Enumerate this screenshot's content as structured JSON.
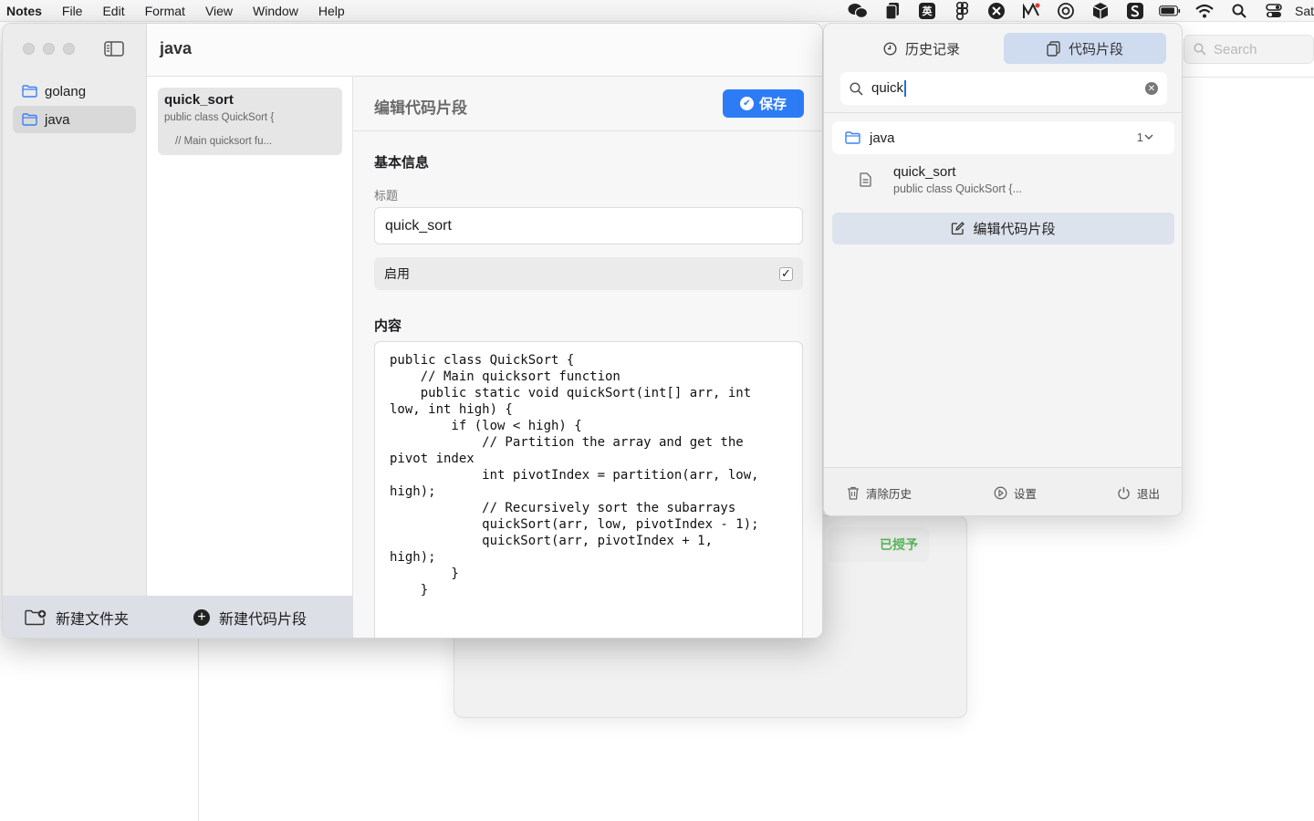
{
  "menubar": {
    "app": "Notes",
    "items": [
      "File",
      "Edit",
      "Format",
      "View",
      "Window",
      "Help"
    ],
    "tray": {
      "ime": "英",
      "overflow_text": "Sat"
    }
  },
  "window": {
    "title": "java",
    "sidebar": {
      "folders": [
        {
          "label": "golang"
        },
        {
          "label": "java"
        }
      ],
      "new_folder_label": "新建文件夹"
    },
    "snippet_list": {
      "items": [
        {
          "title": "quick_sort",
          "line1": "public class QuickSort {",
          "line2": "// Main quicksort fu..."
        }
      ],
      "new_snippet_label": "新建代码片段"
    },
    "editor": {
      "heading": "编辑代码片段",
      "save_label": "保存",
      "basic_info_title": "基本信息",
      "title_label": "标题",
      "title_value": "quick_sort",
      "enable_label": "启用",
      "enabled": true,
      "content_title": "内容",
      "code_lines": [
        "public class QuickSort {",
        "",
        "    // Main quicksort function",
        "    public static void quickSort(int[] arr, int",
        "low, int high) {",
        "        if (low < high) {",
        "            // Partition the array and get the",
        "pivot index",
        "            int pivotIndex = partition(arr, low,",
        "high);",
        "",
        "            // Recursively sort the subarrays",
        "            quickSort(arr, low, pivotIndex - 1);",
        "            quickSort(arr, pivotIndex + 1,",
        "high);",
        "        }",
        "    }"
      ]
    }
  },
  "popover": {
    "tabs": [
      {
        "label": "历史记录",
        "active": false
      },
      {
        "label": "代码片段",
        "active": true
      }
    ],
    "search_value": "quick",
    "group": {
      "label": "java",
      "count": "1"
    },
    "result": {
      "title": "quick_sort",
      "subtitle": "public class QuickSort {..."
    },
    "edit_button_label": "编辑代码片段",
    "footer": {
      "clear_label": "清除历史",
      "settings_label": "设置",
      "quit_label": "退出"
    }
  },
  "background": {
    "search_placeholder": "Search",
    "granted_label": "已授予"
  },
  "colors": {
    "accent": "#2d7cf6",
    "granted_green": "#5ab55a",
    "folder_blue": "#3b82f6"
  }
}
